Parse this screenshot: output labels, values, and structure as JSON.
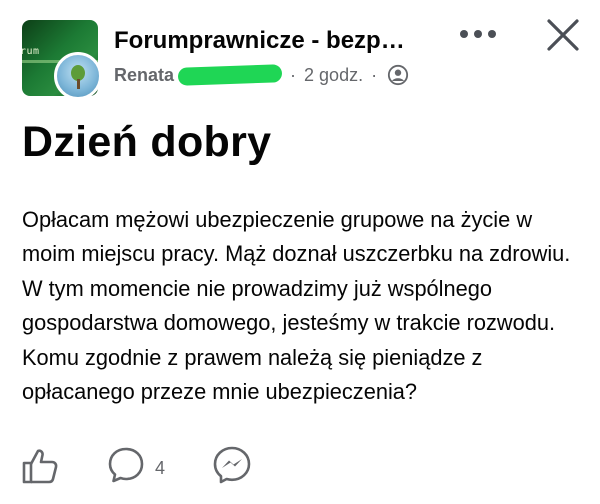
{
  "post": {
    "group_name": "Forumprawnicze - bezp…",
    "author": "Renata",
    "separator": "·",
    "time": "2 godz.",
    "separator2": "·",
    "avatar_text": "rum",
    "title": "Dzień dobry",
    "body": "Opłacam mężowi ubezpieczenie grupowe na życie w moim miejscu pracy. Mąż doznał uszczerbku na zdrowiu. W tym momencie nie prowadzimy już wspólnego gospodarstwa domowego, jesteśmy w trakcie rozwodu. Komu zgodnie z prawem należą się pieniądze z opłacanego przeze mnie ubezpieczenia?",
    "comment_count": "4"
  },
  "icons": {
    "more": "more-horizontal-icon",
    "close": "close-icon",
    "privacy": "public-globe-icon",
    "like": "thumbs-up-icon",
    "comment": "comment-bubble-icon",
    "share": "messenger-icon"
  },
  "colors": {
    "text_primary": "#050505",
    "text_secondary": "#65676b",
    "censor_mark": "#1fd655"
  }
}
